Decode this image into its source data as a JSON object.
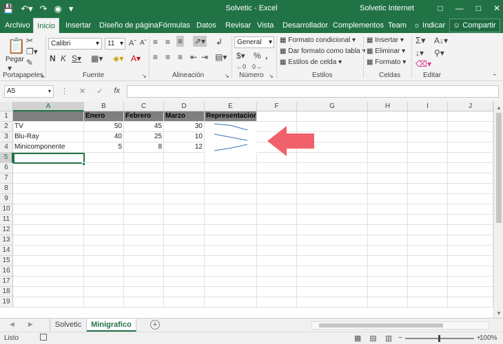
{
  "window": {
    "title": "Solvetic  -  Excel",
    "user": "Solvetic Internet"
  },
  "tabs": [
    {
      "label": "Archivo"
    },
    {
      "label": "Inicio"
    },
    {
      "label": "Insertar"
    },
    {
      "label": "Diseño de página"
    },
    {
      "label": "Fórmulas"
    },
    {
      "label": "Datos"
    },
    {
      "label": "Revisar"
    },
    {
      "label": "Vista"
    },
    {
      "label": "Desarrollador"
    },
    {
      "label": "Complementos"
    },
    {
      "label": "Team"
    },
    {
      "label": "Indicar"
    }
  ],
  "share": "Compartir",
  "ribbon": {
    "clipboard": {
      "paste": "Pegar",
      "label": "Portapapeles"
    },
    "font": {
      "name": "Calibri",
      "size": "11",
      "label": "Fuente"
    },
    "alignment": {
      "label": "Alineación"
    },
    "number": {
      "format": "General",
      "label": "Número"
    },
    "styles": {
      "conditional": "Formato condicional",
      "table": "Dar formato como tabla",
      "cell_styles": "Estilos de celda",
      "label": "Estilos"
    },
    "cells": {
      "insert": "Insertar",
      "delete": "Eliminar",
      "format": "Formato",
      "label": "Celdas"
    },
    "editing": {
      "label": "Editar"
    }
  },
  "formula_bar": {
    "name_box": "A5",
    "fx": "fx",
    "value": ""
  },
  "columns": [
    "A",
    "B",
    "C",
    "D",
    "E",
    "F",
    "G",
    "H",
    "I",
    "J"
  ],
  "rows": [
    "1",
    "2",
    "3",
    "4",
    "5",
    "6",
    "7",
    "8",
    "9",
    "10",
    "11",
    "12",
    "13",
    "14",
    "15",
    "16",
    "17",
    "18",
    "19"
  ],
  "table": {
    "headers": [
      "",
      "Enero",
      "Febrero",
      "Marzo",
      "Representacion"
    ],
    "data": [
      {
        "a": "TV",
        "b": "50",
        "c": "45",
        "d": "30",
        "spark": [
          50,
          45,
          30
        ]
      },
      {
        "a": "Blu-Ray",
        "b": "40",
        "c": "25",
        "d": "10",
        "spark": [
          40,
          25,
          10
        ]
      },
      {
        "a": "Minicomponente",
        "b": "5",
        "c": "8",
        "d": "12",
        "spark": [
          5,
          8,
          12
        ]
      }
    ]
  },
  "sheets": [
    {
      "label": "Solvetic"
    },
    {
      "label": "Minigrafico"
    }
  ],
  "status": {
    "ready": "Listo",
    "zoom": "100%"
  },
  "colors": {
    "accent": "#217346",
    "header_fill": "#7f7f7f",
    "arrow": "#f0616c",
    "sparkline": "#3a6fb7"
  }
}
